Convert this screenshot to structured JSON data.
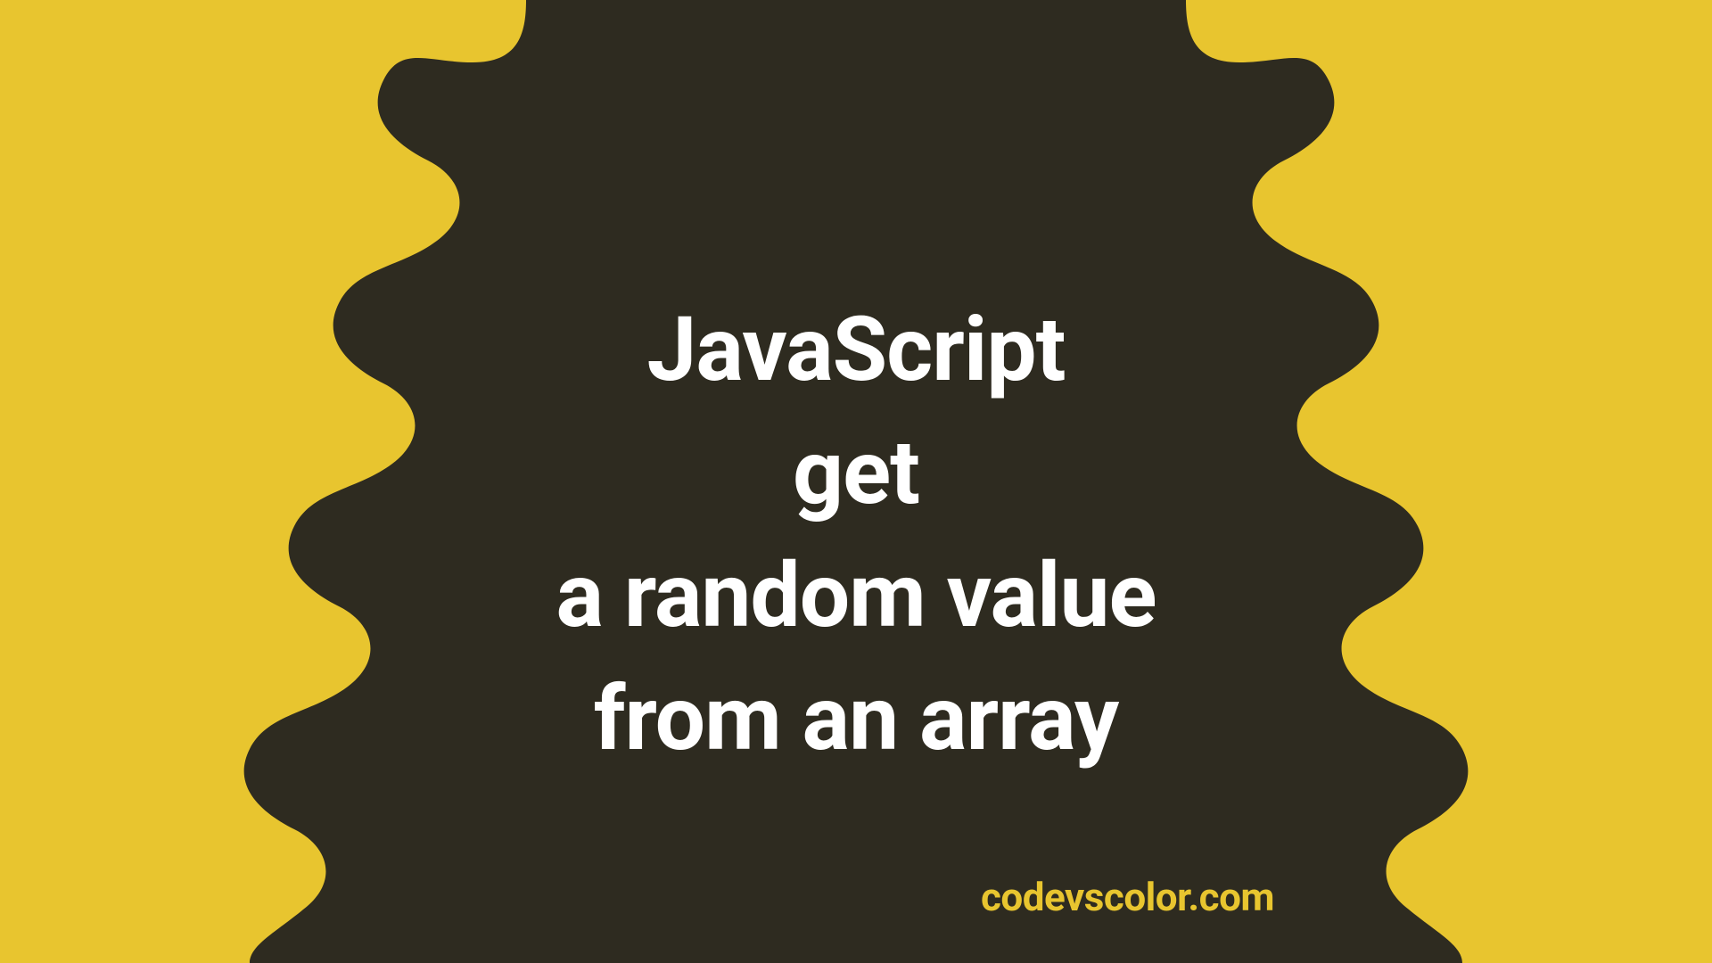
{
  "colors": {
    "background": "#e8c52f",
    "blob": "#2e2b20",
    "title": "#ffffff",
    "credit": "#e8c52f"
  },
  "title": {
    "line1": "JavaScript",
    "line2": "get",
    "line3": "a random value",
    "line4": "from an array"
  },
  "credit": "codevscolor.com"
}
